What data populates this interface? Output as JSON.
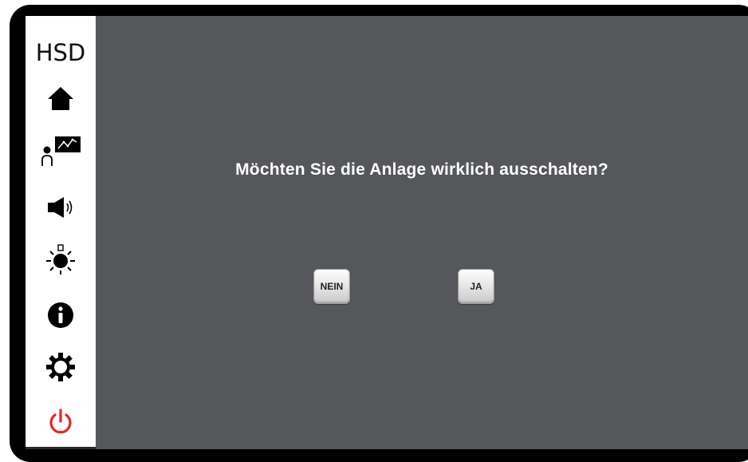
{
  "brand": {
    "logo_text": "HSD"
  },
  "sidebar": {
    "items": [
      {
        "name": "home",
        "icon": "home-icon"
      },
      {
        "name": "user-monitor",
        "icon": "user-chart-icon"
      },
      {
        "name": "volume",
        "icon": "speaker-icon"
      },
      {
        "name": "brightness",
        "icon": "brightness-icon"
      },
      {
        "name": "info",
        "icon": "info-icon"
      },
      {
        "name": "settings",
        "icon": "gear-icon"
      },
      {
        "name": "power",
        "icon": "power-icon"
      }
    ]
  },
  "dialog": {
    "message": "Möchten Sie die Anlage wirklich ausschalten?",
    "no_label": "NEIN",
    "yes_label": "JA"
  },
  "colors": {
    "screen_background": "#55575a",
    "sidebar_background": "#ffffff",
    "power_icon": "#e5262a",
    "text": "#ffffff"
  }
}
